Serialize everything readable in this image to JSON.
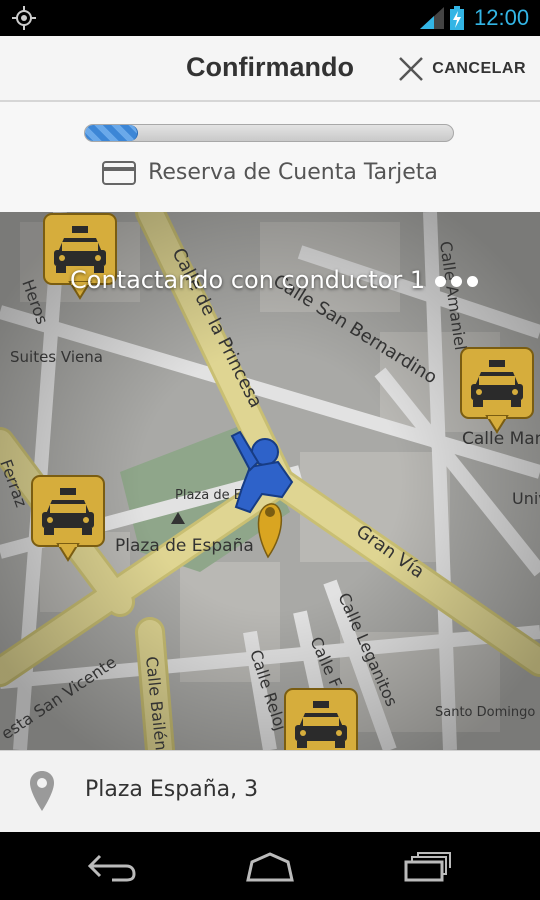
{
  "status_bar": {
    "time": "12:00",
    "accent": "#33b5e5",
    "icons": [
      "location-target-icon",
      "signal-icon",
      "battery-charging-icon"
    ]
  },
  "header": {
    "title": "Confirmando",
    "cancel_label": "CANCELAR"
  },
  "progress": {
    "value": 0.14
  },
  "payment": {
    "label": "Reserva de Cuenta Tarjeta",
    "icon": "credit-card-icon"
  },
  "map": {
    "status": "Contactando con conductor 1",
    "labels": {
      "heros": "Heros",
      "suites": "Suites Viena",
      "princesa": "Calle de la Princesa",
      "san_bernardino": "Calle San Bernardino",
      "amaniel": "Calle Amaniel",
      "calle_man": "Calle Man",
      "plaza_espana_small": "Plaza de E",
      "plaza_espana": "Plaza de España",
      "gran_via": "Gran Vía",
      "ferraz": "Ferraz",
      "univ": "Univ",
      "leganitos": "Calle Leganitos",
      "calle_f": "Calle F",
      "reloj": "Calle Reloj",
      "bailen": "Calle Bailén",
      "san_vicente": "esta San Vicente",
      "santo_domingo": "Santo Domingo"
    },
    "colors": {
      "road_major": "#dfd592",
      "road": "#e2e2e2",
      "park": "#8fa68a",
      "taxi_badge": "#d6ad3c"
    }
  },
  "address": {
    "text": "Plaza España, 3"
  }
}
